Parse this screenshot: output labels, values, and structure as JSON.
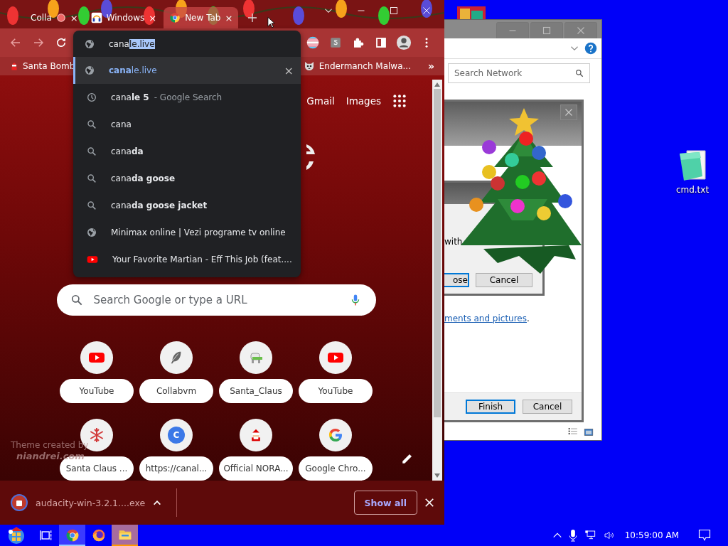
{
  "browser": {
    "tabs": [
      {
        "title": "Colla",
        "kind": "plain",
        "recording": true,
        "selected": false,
        "close": "×"
      },
      {
        "title": "Windows",
        "kind": "audacity",
        "recording": false,
        "selected": false,
        "close": "×"
      },
      {
        "title": "New Tab",
        "kind": "chrome",
        "recording": false,
        "selected": true,
        "close": "×"
      }
    ],
    "omnibox": {
      "typed": "cana",
      "autocomplete": "le.live"
    },
    "suggestions": [
      {
        "kind": "site",
        "text": "**cana**le.live",
        "selected": true,
        "remove": "×"
      },
      {
        "kind": "history",
        "text": "cana**le 5**",
        "detail": "- Google Search",
        "selected": false
      },
      {
        "kind": "search",
        "text": "cana",
        "selected": false
      },
      {
        "kind": "search",
        "text": "cana**da**",
        "selected": false
      },
      {
        "kind": "search",
        "text": "cana**da goose**",
        "selected": false
      },
      {
        "kind": "search",
        "text": "cana**da goose jacket**",
        "selected": false
      },
      {
        "kind": "site",
        "text": "Minimax online | Vezi programe tv online",
        "selected": false
      },
      {
        "kind": "video",
        "text": "Your Favorite Martian - Eff This Job (feat....",
        "selected": false
      }
    ],
    "bookmarks": [
      {
        "label": "Santa Bomb",
        "kind": "santa"
      },
      {
        "label": "Endermanch Malwa...",
        "kind": "cat"
      }
    ],
    "bookmarks_overflow": "»",
    "new_tab": {
      "links": [
        "Gmail",
        "Images"
      ],
      "search_placeholder": "Search Google or type a URL",
      "shortcuts": [
        {
          "title": "YouTube",
          "kind": "youtube"
        },
        {
          "title": "Collabvm",
          "kind": "feather"
        },
        {
          "title": "Santa_Claus",
          "kind": "creature"
        },
        {
          "title": "YouTube",
          "kind": "youtube"
        },
        {
          "title": "Santa Claus ...",
          "kind": "snowflake"
        },
        {
          "title": "https://canal...",
          "kind": "letter",
          "letter": "C"
        },
        {
          "title": "Official NORA...",
          "kind": "santa"
        },
        {
          "title": "Google Chro...",
          "kind": "google"
        }
      ],
      "theme_credit": [
        "Theme created by",
        "niandrei.com"
      ]
    },
    "download": {
      "filename": "audacity-win-3.2.1....exe",
      "show_all": "Show all"
    }
  },
  "explorer": {
    "search_placeholder": "Search Network"
  },
  "wizard": {
    "link": "ments and pictures",
    "link_suffix": ".",
    "buttons": [
      {
        "label": "Finish",
        "default": true
      },
      {
        "label": "Cancel",
        "default": false
      }
    ]
  },
  "dialog": {
    "text": "with",
    "buttons": [
      {
        "label": "ose",
        "default": true
      },
      {
        "label": "Cancel",
        "default": false
      }
    ]
  },
  "desktop_icons": [
    {
      "label": "cmd.txt"
    }
  ],
  "taskbar": {
    "apps": [
      {
        "kind": "taskview",
        "selected": false,
        "attention": false
      },
      {
        "kind": "chrome",
        "selected": true,
        "attention": false
      },
      {
        "kind": "firefox",
        "selected": false,
        "attention": false
      },
      {
        "kind": "explorer",
        "selected": false,
        "attention": true
      }
    ],
    "clock": "10:59:00 AM"
  }
}
